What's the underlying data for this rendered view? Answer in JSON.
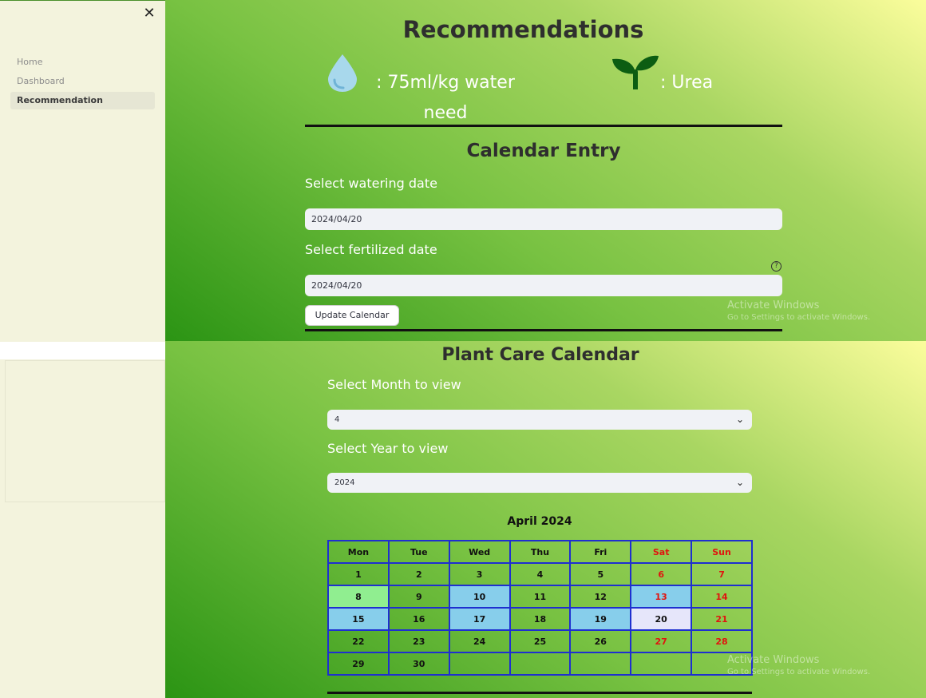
{
  "sidebar": {
    "close_glyph": "✕",
    "items": [
      {
        "label": "Home",
        "active": false
      },
      {
        "label": "Dashboard",
        "active": false
      },
      {
        "label": "Recommendation",
        "active": true
      }
    ]
  },
  "recommendations": {
    "title": "Recommendations",
    "water_text": ": 75ml/kg water need",
    "fertilizer_text": ": Urea",
    "icons": [
      "water-drop-icon",
      "sprout-icon"
    ]
  },
  "calendar_entry": {
    "title": "Calendar Entry",
    "watering_label": "Select watering date",
    "watering_value": "2024/04/20",
    "fertilized_label": "Select fertilized date",
    "fertilized_value": "2024/04/20",
    "help_glyph": "?",
    "update_button": "Update Calendar"
  },
  "watermark": {
    "title": "Activate Windows",
    "subtitle": "Go to Settings to activate Windows."
  },
  "plant_care": {
    "title": "Plant Care Calendar",
    "month_label": "Select Month to view",
    "month_value": "4",
    "year_label": "Select Year to view",
    "year_value": "2024",
    "chevron": "⌄"
  },
  "calendar": {
    "month_title": "April 2024",
    "weekdays": [
      "Mon",
      "Tue",
      "Wed",
      "Thu",
      "Fri",
      "Sat",
      "Sun"
    ],
    "weeks": [
      [
        "1",
        "2",
        "3",
        "4",
        "5",
        "6",
        "7"
      ],
      [
        "8",
        "9",
        "10",
        "11",
        "12",
        "13",
        "14"
      ],
      [
        "15",
        "16",
        "17",
        "18",
        "19",
        "20",
        "21"
      ],
      [
        "22",
        "23",
        "24",
        "25",
        "26",
        "27",
        "28"
      ],
      [
        "29",
        "30",
        "",
        "",
        "",
        "",
        ""
      ]
    ],
    "highlights": {
      "8": "#90ee90",
      "10": "#87ceeb",
      "13": "#87ceeb",
      "15": "#87ceeb",
      "17": "#87ceeb",
      "19": "#87ceeb",
      "20": "#e6e6fa"
    },
    "weekend_color": "#e0140f",
    "border_color": "#1e2fd0"
  }
}
